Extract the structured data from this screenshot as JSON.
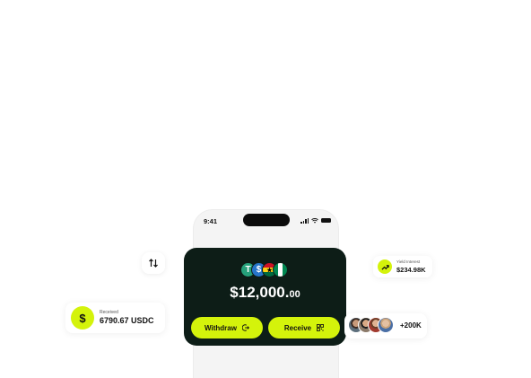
{
  "phone": {
    "status_time": "9:41"
  },
  "wallet": {
    "currencies": [
      "tether-icon",
      "usdc-icon",
      "ghana-flag-icon",
      "nigeria-flag-icon"
    ],
    "balance_main": "$12,000.",
    "balance_cents": "00",
    "withdraw_label": "Withdraw",
    "receive_label": "Receive"
  },
  "received": {
    "label": "Received",
    "value": "6790.67 USDC",
    "icon": "dollar-icon"
  },
  "yield": {
    "label": "Yield Interest",
    "value": "$234.98K",
    "icon": "trend-up-icon"
  },
  "users": {
    "count": "+200K"
  },
  "colors": {
    "accent": "#d4f30b",
    "card_dark": "#0d1d17",
    "background": "#ffffff"
  }
}
